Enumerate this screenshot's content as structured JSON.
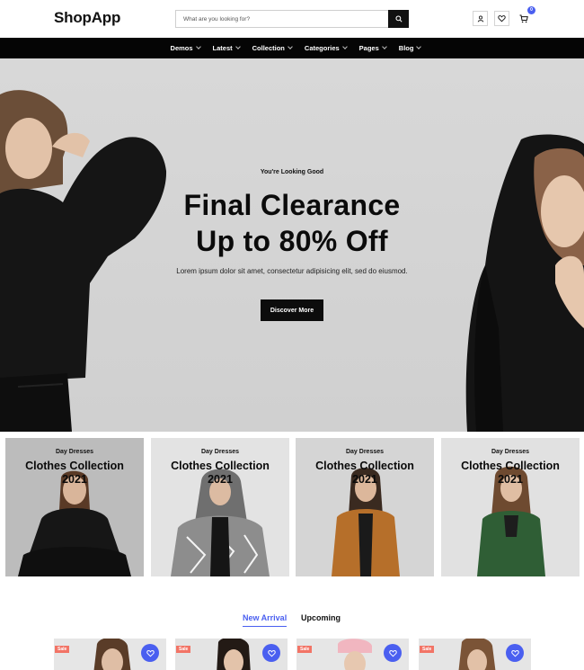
{
  "header": {
    "logo": "ShopApp",
    "search": {
      "placeholder": "What are you looking for?"
    },
    "icons": [
      "search-icon",
      "user-icon",
      "heart-icon",
      "cart-icon"
    ],
    "cart_count": "0"
  },
  "nav": {
    "items": [
      {
        "label": "Demos"
      },
      {
        "label": "Latest"
      },
      {
        "label": "Collection"
      },
      {
        "label": "Categories"
      },
      {
        "label": "Pages"
      },
      {
        "label": "Blog"
      }
    ]
  },
  "hero": {
    "eyebrow": "You're Looking Good",
    "title_line1": "Final Clearance",
    "title_line2": "Up to 80% Off",
    "description": "Lorem ipsum dolor sit amet, consectetur adipisicing elit, sed do eiusmod.",
    "button": "Discover More"
  },
  "collections": [
    {
      "subtitle": "Day Dresses",
      "title": "Clothes Collection",
      "year": "2021"
    },
    {
      "subtitle": "Day Dresses",
      "title": "Clothes Collection",
      "year": "2021"
    },
    {
      "subtitle": "Day Dresses",
      "title": "Clothes Collection",
      "year": "2021"
    },
    {
      "subtitle": "Day Dresses",
      "title": "Clothes Collection",
      "year": "2021"
    }
  ],
  "tabs": [
    {
      "label": "New Arrival",
      "active": true
    },
    {
      "label": "Upcoming",
      "active": false
    }
  ],
  "products": [
    {
      "badge": "Sale"
    },
    {
      "badge": "Sale"
    },
    {
      "badge": "Sale"
    },
    {
      "badge": "Sale"
    }
  ],
  "colors": {
    "accent": "#4a5ff0",
    "sale_badge": "#f27466",
    "nav_bg": "#050505",
    "hero_bg": "#d5d5d5"
  }
}
